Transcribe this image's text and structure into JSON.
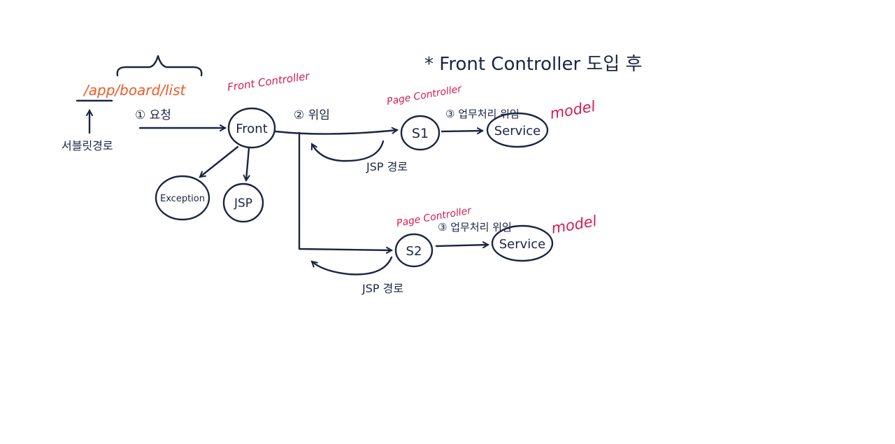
{
  "title": "* Front Controller 도입 후",
  "url_path": "/app/board/list",
  "servlet_path_label": "서블릿경로",
  "steps": {
    "request": "① 요청",
    "delegate": "② 위임",
    "business_delegate_1": "③ 업무처리 위임",
    "business_delegate_2": "③ 업무처리 위임"
  },
  "nodes": {
    "front": "Front",
    "exception": "Exception",
    "jsp": "JSP",
    "s1": "S1",
    "s2": "S2",
    "service1": "Service",
    "service2": "Service"
  },
  "role_labels": {
    "front_controller": "Front Controller",
    "page_controller_1": "Page Controller",
    "page_controller_2": "Page Controller",
    "model_1": "model",
    "model_2": "model"
  },
  "return_labels": {
    "jsp_path_1": "JSP 경로",
    "jsp_path_2": "JSP 경로"
  },
  "colors": {
    "ink": "#1b2544",
    "annotation_red": "#d81b4f",
    "path_orange": "#ee5a2a"
  }
}
